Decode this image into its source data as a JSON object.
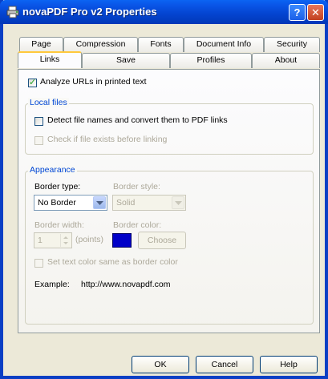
{
  "window": {
    "title": "novaPDF Pro v2 Properties",
    "help_glyph": "?",
    "close_glyph": "✕",
    "icon": "printer-icon"
  },
  "tabs": {
    "row_back": [
      "Page",
      "Compression",
      "Fonts",
      "Document Info",
      "Security"
    ],
    "row_front": [
      "Links",
      "Save",
      "Profiles",
      "About"
    ],
    "active": "Links"
  },
  "links": {
    "analyze_urls": {
      "label": "Analyze URLs in printed text",
      "checked": true
    },
    "local_files": {
      "title": "Local files",
      "detect": {
        "label": "Detect file names and convert them to PDF links",
        "checked": false
      },
      "check_exists": {
        "label": "Check if file exists before linking",
        "checked": false,
        "enabled": false
      }
    },
    "appearance": {
      "title": "Appearance",
      "border_type_label": "Border type:",
      "border_type_value": "No Border",
      "border_style_label": "Border style:",
      "border_style_value": "Solid",
      "border_width_label": "Border width:",
      "border_width_value": "1",
      "border_width_unit": "(points)",
      "border_color_label": "Border color:",
      "border_color": "#0000c8",
      "choose_label": "Choose",
      "same_color": {
        "label": "Set text color same as border color",
        "checked": false,
        "enabled": false
      },
      "example_label": "Example:",
      "example_value": "http://www.novapdf.com"
    }
  },
  "buttons": {
    "ok": "OK",
    "cancel": "Cancel",
    "help": "Help"
  },
  "colors": {
    "titlebar": "#0a56e8",
    "dialog_bg": "#ece9d8",
    "group_title": "#0046d5",
    "checkmark": "#21a121"
  }
}
